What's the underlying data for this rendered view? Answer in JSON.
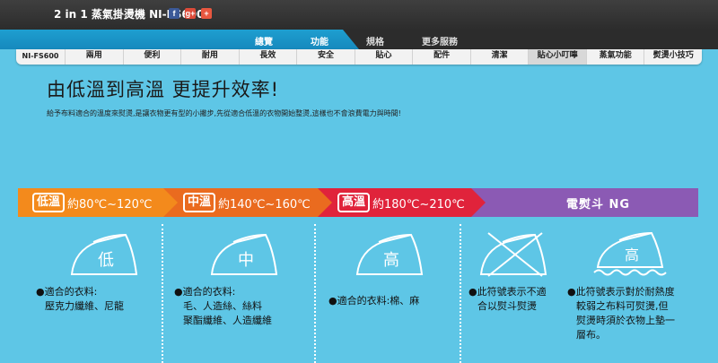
{
  "header": {
    "title": "2 in 1 蒸氣掛燙機 NI-FS600",
    "social": [
      "f",
      "g+",
      "+"
    ]
  },
  "nav": {
    "overview": "總覽",
    "features": "功能",
    "specs": "規格",
    "more": "更多服務"
  },
  "subnav": {
    "model": "NI-FS600",
    "tabs": [
      "兩用",
      "便利",
      "耐用",
      "長效",
      "安全",
      "貼心",
      "配件",
      "清潔",
      "貼心小叮嚀",
      "蒸氣功能",
      "熨燙小技巧"
    ],
    "active_index": 8
  },
  "content": {
    "headline": "由低溫到高溫 更提升效率!",
    "description": "給予布料適合的溫度來熨燙,是讓衣物更有型的小撇步,先從適合低溫的衣物開始整燙,這樣也不會浪費電力與時間!"
  },
  "temperature": {
    "low": {
      "badge": "低溫",
      "range": "約80℃~120℃",
      "color": "#f38a1c"
    },
    "mid": {
      "badge": "中溫",
      "range": "約140℃~160℃",
      "color": "#ea6b1f"
    },
    "high": {
      "badge": "高溫",
      "range": "約180℃~210℃",
      "color": "#e0233b"
    },
    "ng": {
      "label": "電熨斗 NG",
      "color": "#8b5ab4"
    }
  },
  "icons": {
    "low": "低",
    "mid": "中",
    "high": "高",
    "steam": "高"
  },
  "captions": {
    "low": [
      "●適合的衣料:",
      "壓克力纖維、尼龍"
    ],
    "mid": [
      "●適合的衣料:",
      "毛、人造絲、絲料",
      "聚酯纖維、人造纖維"
    ],
    "high": [
      "●適合的衣料:棉、麻"
    ],
    "ng": [
      "●此符號表示不適",
      "合以熨斗熨燙"
    ],
    "steam": [
      "●此符號表示對於耐熱度",
      "較弱之布料可熨燙,但",
      "熨燙時須於衣物上墊一",
      "層布。"
    ]
  }
}
